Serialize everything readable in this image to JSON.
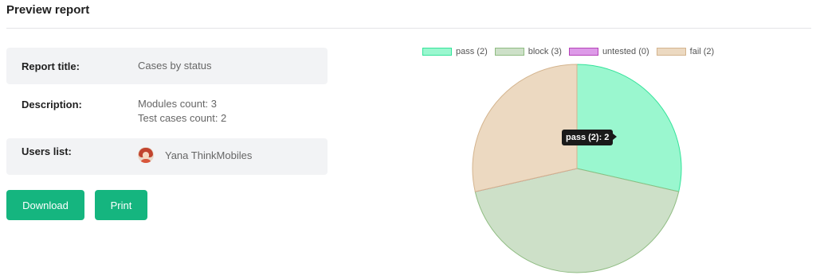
{
  "header": {
    "title": "Preview report"
  },
  "details": {
    "report_title_label": "Report title:",
    "report_title_value": "Cases by status",
    "description_label": "Description:",
    "description_line1": "Modules count: 3",
    "description_line2": "Test cases count: 2",
    "users_label": "Users list:",
    "user_name": "Yana ThinkMobiles"
  },
  "actions": {
    "download_label": "Download",
    "print_label": "Print"
  },
  "chart_data": {
    "type": "pie",
    "title": "",
    "categories": [
      "pass (2)",
      "block (3)",
      "untested (0)",
      "fail (2)"
    ],
    "values": [
      2,
      3,
      0,
      2
    ],
    "colors": {
      "fill": [
        "#9af7cf",
        "#cde0c8",
        "#dd9ae8",
        "#ecd9c1"
      ],
      "stroke": [
        "#34e39a",
        "#8fbc82",
        "#b543b8",
        "#d4b48e"
      ]
    },
    "legend_position": "top",
    "tooltip": "pass (2): 2"
  }
}
